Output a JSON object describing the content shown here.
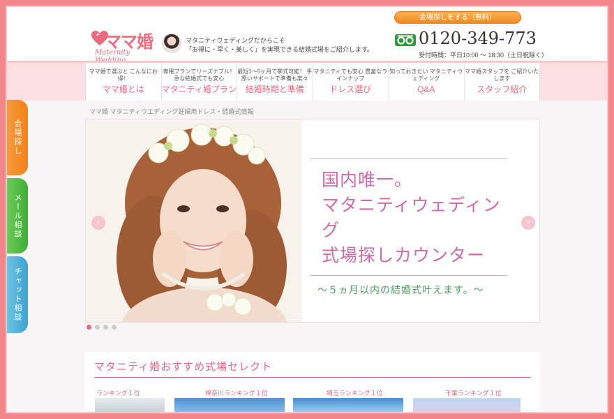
{
  "header": {
    "logo_text": "ママ婚",
    "logo_sub": "Maternity Wedding",
    "tagline_1": "マタニティウェディングだからこそ",
    "tagline_2": "「お得に・早く・美しく」を実現できる結婚式場をご紹介します。",
    "search_button": "会場探しをする（無料）",
    "phone": "0120-349-773",
    "hours": "受付時間：平日10:00 〜 18:30（土日祝除く）"
  },
  "nav": [
    {
      "sub": "ママ婚で選ぶと こんなにお得！",
      "label": "ママ婚とは"
    },
    {
      "sub": "専用プランでリーズナブル！ 急な結婚式でも安心",
      "label": "マタニティ婚プラン"
    },
    {
      "sub": "最短1〜5ヶ月で挙式可能！ 手厚いサポートで準備も楽々",
      "label": "結婚時期と準備"
    },
    {
      "sub": "マタニティでも安心 豊富なラインナップ",
      "label": "ドレス選び"
    },
    {
      "sub": "知っておきたい マタニティウェディング",
      "label": "Q&A"
    },
    {
      "sub": "ママ婚スタッフを ご紹介いたします",
      "label": "スタッフ紹介"
    }
  ],
  "breadcrumb": "ママ婚 マタニティウエディング妊婦用ドレス・結婚式情報",
  "side_tabs": {
    "venue": "会場探し",
    "mail": "メール相談",
    "chat": "チャット相談"
  },
  "hero": {
    "headline_1": "国内唯一。",
    "headline_2": "マタニティウェディング",
    "headline_3": "式場探しカウンター",
    "sub": "〜５ヵ月以内の結婚式叶えます。〜",
    "prev": "‹",
    "next": "›"
  },
  "recommend": {
    "title": "マタニティ婚おすすめ式場セレクト",
    "rankings": [
      "ランキング１位",
      "神奈川ランキング１位",
      "埼玉ランキング１位",
      "千葉ランキング１位"
    ]
  },
  "colors": {
    "brand_pink": "#e96a7f",
    "frame": "#f2858a",
    "venue_tab": "#f48116",
    "mail_tab": "#3fae35",
    "chat_tab": "#3aa2cf"
  },
  "icons": [
    "heart-logo-icon",
    "freedial-icon",
    "chevron-left-icon",
    "chevron-right-icon"
  ]
}
